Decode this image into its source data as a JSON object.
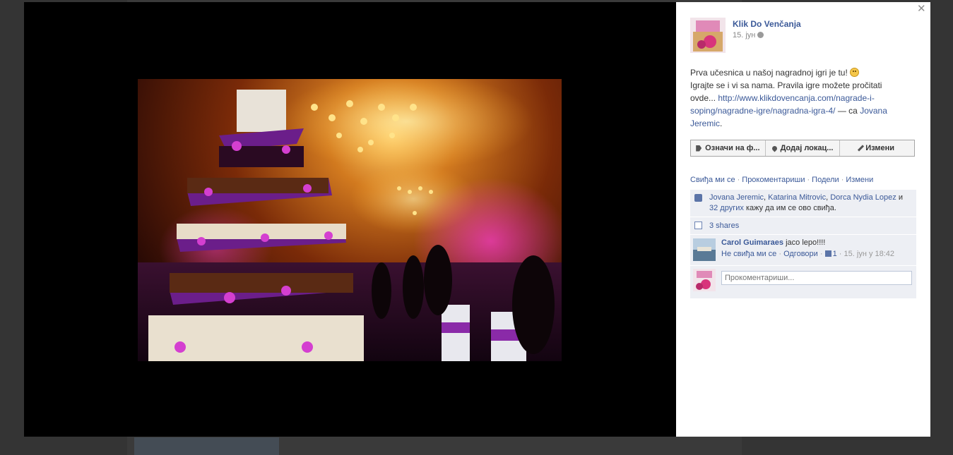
{
  "post": {
    "author": "Klik Do Venčanja",
    "date": "15. јун",
    "text_line1": "Prva učesnica u našoj nagradnoj igri je tu!",
    "text_line2": "Igrajte se i vi sa nama. Pravila igre možete pročitati ovde...",
    "link": "http://www.klikdovencanja.com/nagrade-i-soping/nagradne-igre/nagradna-igra-4/",
    "with_prefix": "— са",
    "with_name": "Jovana Jeremic",
    "with_suffix": "."
  },
  "toolbar": {
    "tag_label": "Означи на ф...",
    "location_label": "Додај локац...",
    "edit_label": "Измени"
  },
  "actions": {
    "like": "Свиђа ми се",
    "comment": "Прокоментариши",
    "share": "Подели",
    "edit": "Измени"
  },
  "likes": {
    "name1": "Jovana Jeremic",
    "name2": "Katarina Mitrovic",
    "name3": "Dorca Nydia Lopez",
    "and": "и",
    "others_link": "32 других",
    "suffix": "кажу да им се ово свиђа."
  },
  "shares": {
    "label": "3 shares"
  },
  "comment": {
    "author": "Carol Guimaraes",
    "text": "jaco lepo!!!!",
    "unlike": "Не свиђа ми се",
    "reply": "Одговори",
    "like_count": "1",
    "time": "15. јун у 18:42"
  },
  "reply_box": {
    "placeholder": "Прокоментариши..."
  },
  "colors": {
    "link": "#3b5998",
    "ufi_bg": "#edeff4",
    "stage_bg": "#000000"
  }
}
